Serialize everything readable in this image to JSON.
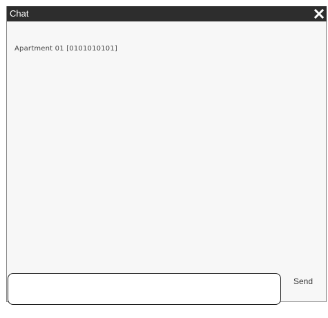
{
  "window": {
    "title": "Chat",
    "close_icon": "close-icon"
  },
  "conversation": {
    "room_label": "Apartment 01 [0101010101]"
  },
  "composer": {
    "message_value": "",
    "send_label": "Send"
  },
  "colors": {
    "titlebar_bg": "#2d2d2d",
    "panel_bg": "#f7f7f7",
    "text": "#444444"
  }
}
